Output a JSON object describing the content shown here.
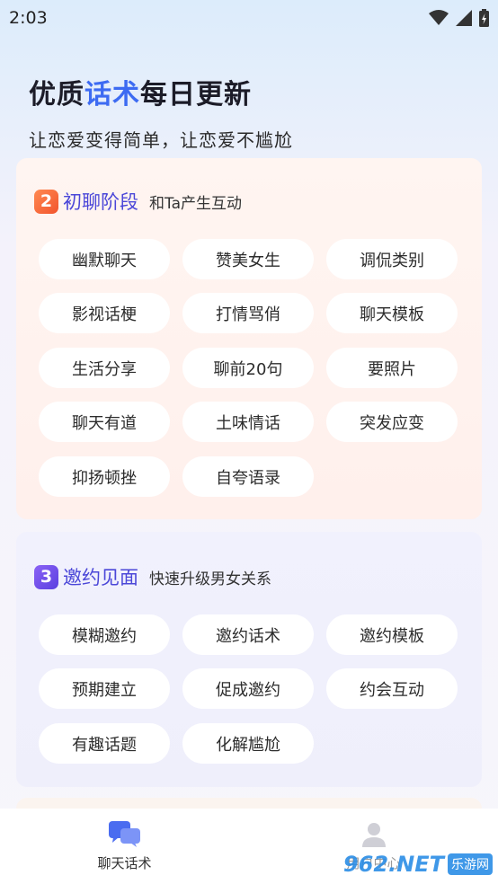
{
  "status_bar": {
    "time": "2:03"
  },
  "hero": {
    "title_part1": "优质",
    "title_accent": "话术",
    "title_part2": "每日更新",
    "subtitle": "让恋爱变得简单，让恋爱不尴尬"
  },
  "sections": [
    {
      "badge": "2",
      "title": "初聊阶段",
      "subtitle": "和Ta产生互动",
      "tags": [
        "幽默聊天",
        "赞美女生",
        "调侃类别",
        "影视话梗",
        "打情骂俏",
        "聊天模板",
        "生活分享",
        "聊前20句",
        "要照片",
        "聊天有道",
        "土味情话",
        "突发应变",
        "抑扬顿挫",
        "自夸语录"
      ]
    },
    {
      "badge": "3",
      "title": "邀约见面",
      "subtitle": "快速升级男女关系",
      "tags": [
        "模糊邀约",
        "邀约话术",
        "邀约模板",
        "预期建立",
        "促成邀约",
        "约会互动",
        "有趣话题",
        "化解尴尬"
      ]
    }
  ],
  "bottom_nav": {
    "items": [
      {
        "label": "聊天话术",
        "icon": "chat-bubbles-icon",
        "active": true
      },
      {
        "label": "用户中心",
        "icon": "user-icon",
        "active": false
      }
    ]
  },
  "watermark": {
    "main": "962.NET",
    "sub": "乐游网"
  },
  "colors": {
    "accent": "#3d6bf2",
    "section_title": "#4b47d8",
    "badge_orange": "#f2542d",
    "badge_purple": "#5a3fe0",
    "nav_active": "#4a6cf0"
  }
}
